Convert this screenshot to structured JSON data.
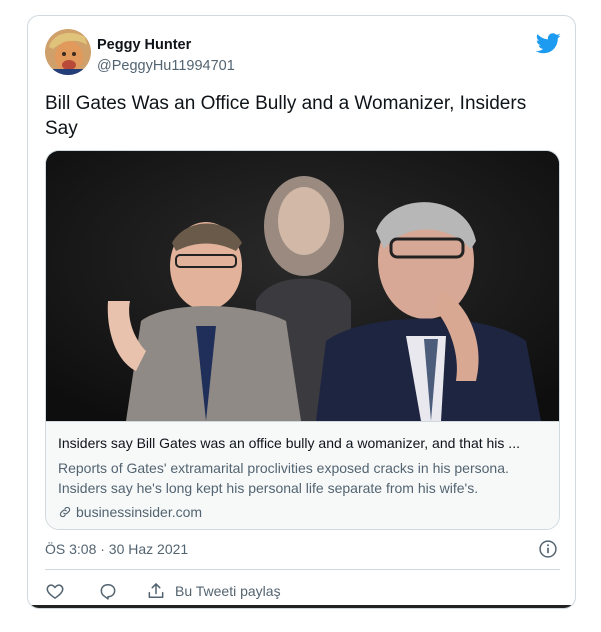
{
  "author": {
    "name": "Peggy Hunter",
    "handle": "@PeggyHu11994701"
  },
  "tweet": {
    "text": "Bill Gates Was an Office Bully and a Womanizer, Insiders Say"
  },
  "card": {
    "title": "Insiders say Bill Gates was an office bully and a womanizer, and that his ...",
    "description": "Reports of Gates' extramarital proclivities exposed cracks in his persona. Insiders say he's long kept his personal life separate from his wife's.",
    "domain": "businessinsider.com"
  },
  "timestamp": "ÖS 3:08 · 30 Haz 2021",
  "actions": {
    "share_label": "Bu Tweeti paylaş"
  },
  "icons": {
    "bird": "twitter-bird-icon",
    "info": "info-icon",
    "like": "heart-icon",
    "reply": "reply-bubble-icon",
    "share": "share-upload-icon",
    "link": "link-icon"
  },
  "colors": {
    "brand": "#1d9bf0",
    "text_secondary": "#536471"
  }
}
